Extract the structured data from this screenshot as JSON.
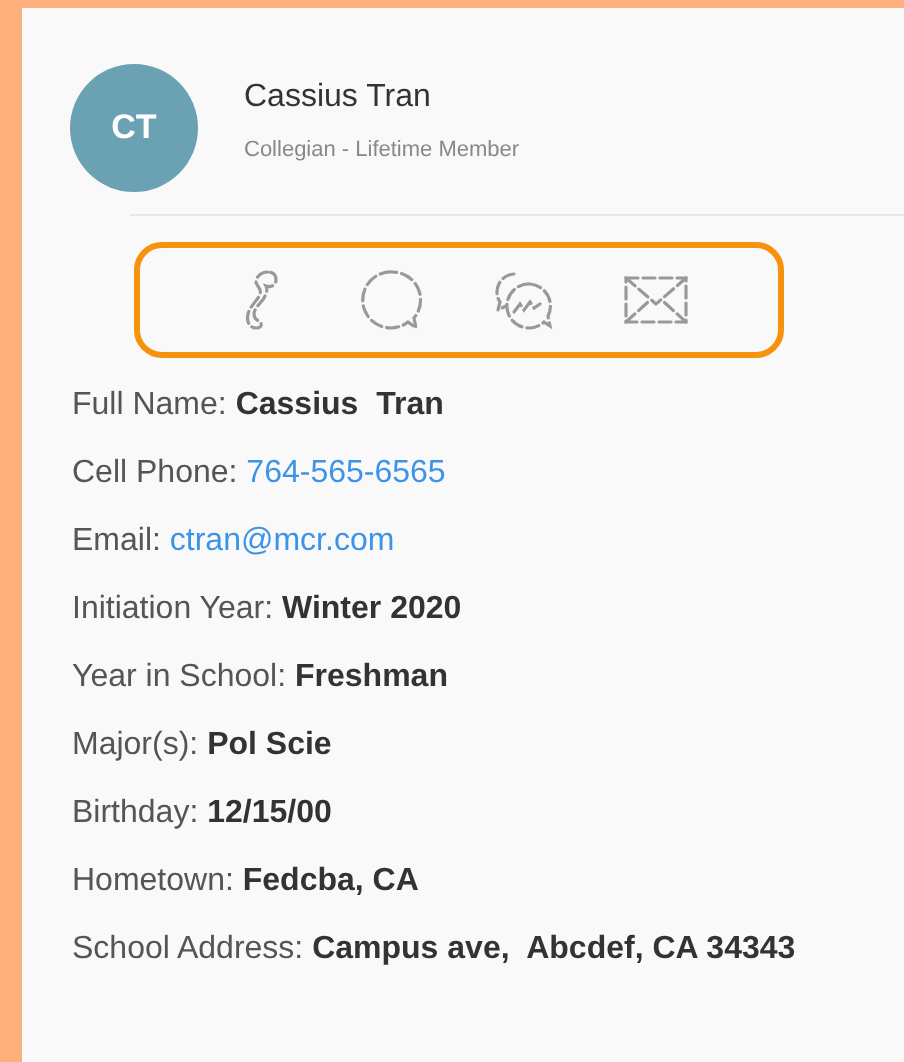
{
  "profile": {
    "initials": "CT",
    "name": "Cassius Tran",
    "subtitle": "Collegian - Lifetime Member"
  },
  "actions": [
    {
      "kind": "phone"
    },
    {
      "kind": "chat"
    },
    {
      "kind": "group-chat"
    },
    {
      "kind": "email"
    }
  ],
  "fields": [
    {
      "label": "Full Name:",
      "value": "Cassius  Tran",
      "kind": "text"
    },
    {
      "label": "Cell Phone:",
      "value": "764-565-6565",
      "kind": "link"
    },
    {
      "label": "Email:",
      "value": "ctran@mcr.com",
      "kind": "link"
    },
    {
      "label": "Initiation Year:",
      "value": "Winter 2020",
      "kind": "text"
    },
    {
      "label": "Year in School:",
      "value": "Freshman",
      "kind": "text"
    },
    {
      "label": "Major(s):",
      "value": "Pol Scie",
      "kind": "text"
    },
    {
      "label": "Birthday:",
      "value": "12/15/00",
      "kind": "text"
    },
    {
      "label": "Hometown:",
      "value": "Fedcba, CA",
      "kind": "text"
    },
    {
      "label": "School Address:",
      "value": "Campus ave,  Abcdef, CA 34343",
      "kind": "text"
    }
  ]
}
